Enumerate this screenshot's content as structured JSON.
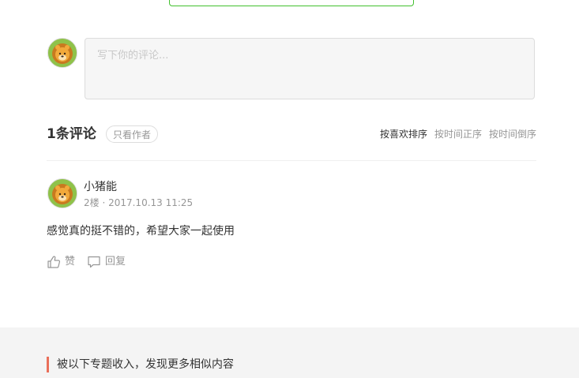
{
  "compose": {
    "placeholder": "写下你的评论..."
  },
  "comments_header": {
    "count_label": "1条评论",
    "author_only_label": "只看作者",
    "sort_options": [
      "按喜欢排序",
      "按时间正序",
      "按时间倒序"
    ],
    "active_sort": "按喜欢排序"
  },
  "comment": {
    "author": "小猪能",
    "meta": "2楼 · 2017.10.13 11:25",
    "text": "感觉真的挺不错的，希望大家一起使用",
    "like_label": "赞",
    "reply_label": "回复"
  },
  "collections": {
    "title": "被以下专题收入，发现更多相似内容"
  },
  "colors": {
    "accent_green": "#42c02e",
    "accent_red": "#ea6f5a",
    "muted_text": "#969696"
  },
  "icons": {
    "avatar": "lion-avatar-icon",
    "like": "thumbs-up-icon",
    "reply": "speech-bubble-icon"
  }
}
